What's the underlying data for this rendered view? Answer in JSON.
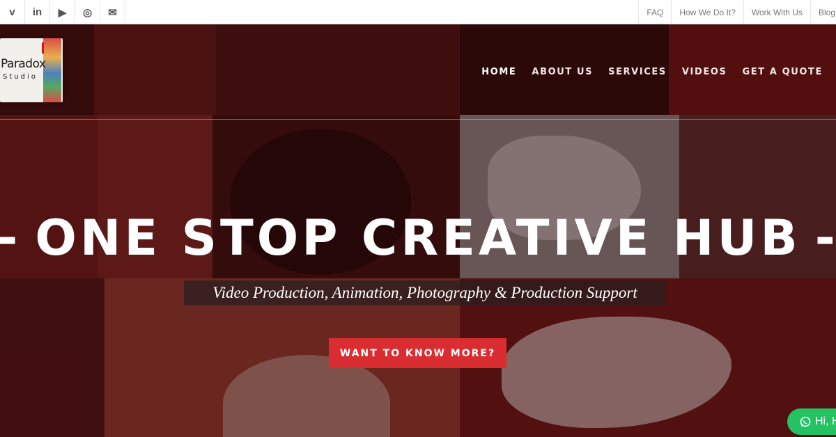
{
  "social": {
    "icons": [
      "vimeo-icon",
      "linkedin-icon",
      "youtube-icon",
      "instagram-icon",
      "envelope-icon"
    ],
    "vimeo_glyph": "v",
    "linkedin_glyph": "in",
    "youtube_glyph": "▶",
    "instagram_glyph": "◎",
    "envelope_glyph": "✉"
  },
  "toplinks": [
    "FAQ",
    "How We Do It?",
    "Work With Us",
    "Blog"
  ],
  "logo": {
    "name": "Paradox",
    "sub": "Studio"
  },
  "nav": [
    "HOME",
    "ABOUT US",
    "SERVICES",
    "VIDEOS",
    "GET A QUOTE"
  ],
  "hero": {
    "headline_dash": "-",
    "headline": "ONE STOP CREATIVE HUB",
    "subline": "Video Production, Animation, Photography & Production Support",
    "cta": "WANT TO KNOW MORE?"
  },
  "chat": {
    "label": "Hi, H"
  },
  "colors": {
    "accent": "#d92d31",
    "chat": "#25c264",
    "hero_tint": "#5a1010"
  }
}
